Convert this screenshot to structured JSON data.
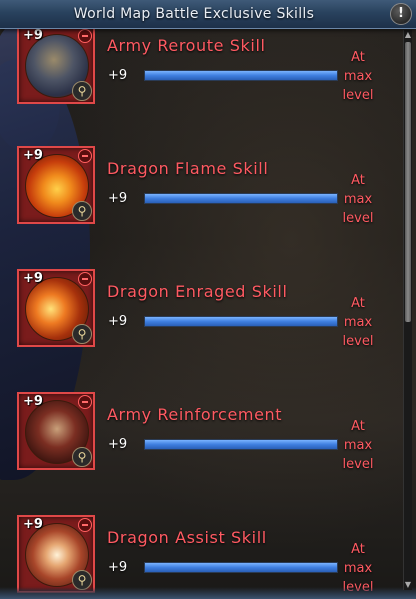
{
  "window": {
    "title": "World Map Battle Exclusive Skills",
    "info_glyph": "!"
  },
  "skills": [
    {
      "name": "Army Reroute Skill",
      "level_badge": "+9",
      "level": "+9",
      "status_line1": "At",
      "status_line2": "max",
      "status_line3": "level",
      "progress": 1.0,
      "icon": "army-reroute-icon"
    },
    {
      "name": "Dragon Flame Skill",
      "level_badge": "+9",
      "level": "+9",
      "status_line1": "At",
      "status_line2": "max",
      "status_line3": "level",
      "progress": 1.0,
      "icon": "dragon-flame-icon"
    },
    {
      "name": "Dragon Enraged Skill",
      "level_badge": "+9",
      "level": "+9",
      "status_line1": "At",
      "status_line2": "max",
      "status_line3": "level",
      "progress": 1.0,
      "icon": "dragon-enraged-icon"
    },
    {
      "name": "Army Reinforcement",
      "level_badge": "+9",
      "level": "+9",
      "status_line1": "At",
      "status_line2": "max",
      "status_line3": "level",
      "progress": 1.0,
      "icon": "army-reinforcement-icon"
    },
    {
      "name": "Dragon Assist Skill",
      "level_badge": "+9",
      "level": "+9",
      "status_line1": "At",
      "status_line2": "max",
      "status_line3": "level",
      "progress": 1.0,
      "icon": "dragon-assist-icon"
    }
  ],
  "colors": {
    "skill_name": "#ff5a62",
    "progress_fill": "#3f7fe0",
    "icon_border": "#e04848",
    "title_bar": "#29425e"
  }
}
